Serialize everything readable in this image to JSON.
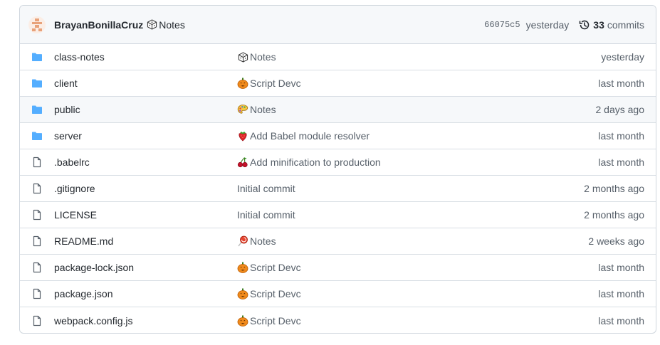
{
  "header": {
    "author": "BrayanBonillaCruz",
    "message": "Notes",
    "message_icon": "dice-icon",
    "sha": "66075c5",
    "time": "yesterday",
    "commit_count": "33",
    "commits_label": "commits"
  },
  "files": [
    {
      "name": "class-notes",
      "type": "dir",
      "message": "Notes",
      "icon": "dice",
      "time": "yesterday"
    },
    {
      "name": "client",
      "type": "dir",
      "message": "Script Devc",
      "icon": "pumpkin",
      "time": "last month"
    },
    {
      "name": "public",
      "type": "dir",
      "message": "Notes",
      "icon": "palette",
      "time": "2 days ago"
    },
    {
      "name": "server",
      "type": "dir",
      "message": "Add Babel module resolver",
      "icon": "strawberry",
      "time": "last month"
    },
    {
      "name": ".babelrc",
      "type": "file",
      "message": "Add minification to production",
      "icon": "cherries",
      "time": "last month"
    },
    {
      "name": ".gitignore",
      "type": "file",
      "message": "Initial commit",
      "icon": "",
      "time": "2 months ago"
    },
    {
      "name": "LICENSE",
      "type": "file",
      "message": "Initial commit",
      "icon": "",
      "time": "2 months ago"
    },
    {
      "name": "README.md",
      "type": "file",
      "message": "Notes",
      "icon": "lollipop",
      "time": "2 weeks ago"
    },
    {
      "name": "package-lock.json",
      "type": "file",
      "message": "Script Devc",
      "icon": "pumpkin",
      "time": "last month"
    },
    {
      "name": "package.json",
      "type": "file",
      "message": "Script Devc",
      "icon": "pumpkin",
      "time": "last month"
    },
    {
      "name": "webpack.config.js",
      "type": "file",
      "message": "Script Devc",
      "icon": "pumpkin",
      "time": "last month"
    }
  ],
  "colors": {
    "folder": "#54aeff",
    "file_icon": "#57606a",
    "border": "#d0d7de",
    "header_bg": "#f6f8fa"
  }
}
